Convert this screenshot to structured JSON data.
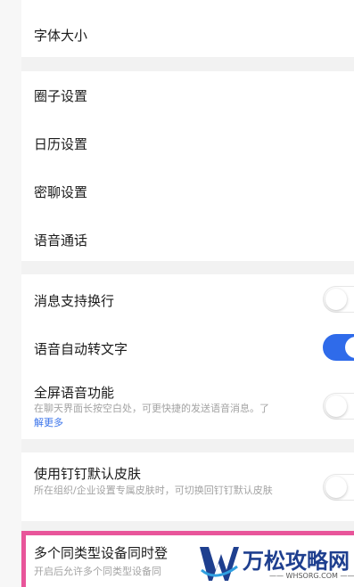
{
  "settings": {
    "font_size": "字体大小",
    "circle": "圈子设置",
    "calendar": "日历设置",
    "secret_chat": "密聊设置",
    "voice_call": "语音通话",
    "msg_newline": {
      "label": "消息支持换行",
      "on": false
    },
    "voice_to_text": {
      "label": "语音自动转文字",
      "on": true
    },
    "fullscreen_voice": {
      "label": "全屏语音功能",
      "desc": "在聊天界面长按空白处，可更快捷的发送语音消息。了",
      "more": "解更多",
      "on": false
    },
    "default_skin": {
      "label": "使用钉钉默认皮肤",
      "desc": "所在组织/企业设置专属皮肤时，可切换回钉钉默认皮肤",
      "on": false
    },
    "multi_device": {
      "label": "多个同类型设备同时登",
      "desc": "开启后允许多个同类型设备同"
    }
  },
  "watermark": {
    "brand": "万松攻略网",
    "site": "—— WHSORG.COM ——"
  },
  "colors": {
    "toggle_on": "#2f6bea",
    "link": "#3a73ea",
    "highlight": "#e8559a"
  }
}
